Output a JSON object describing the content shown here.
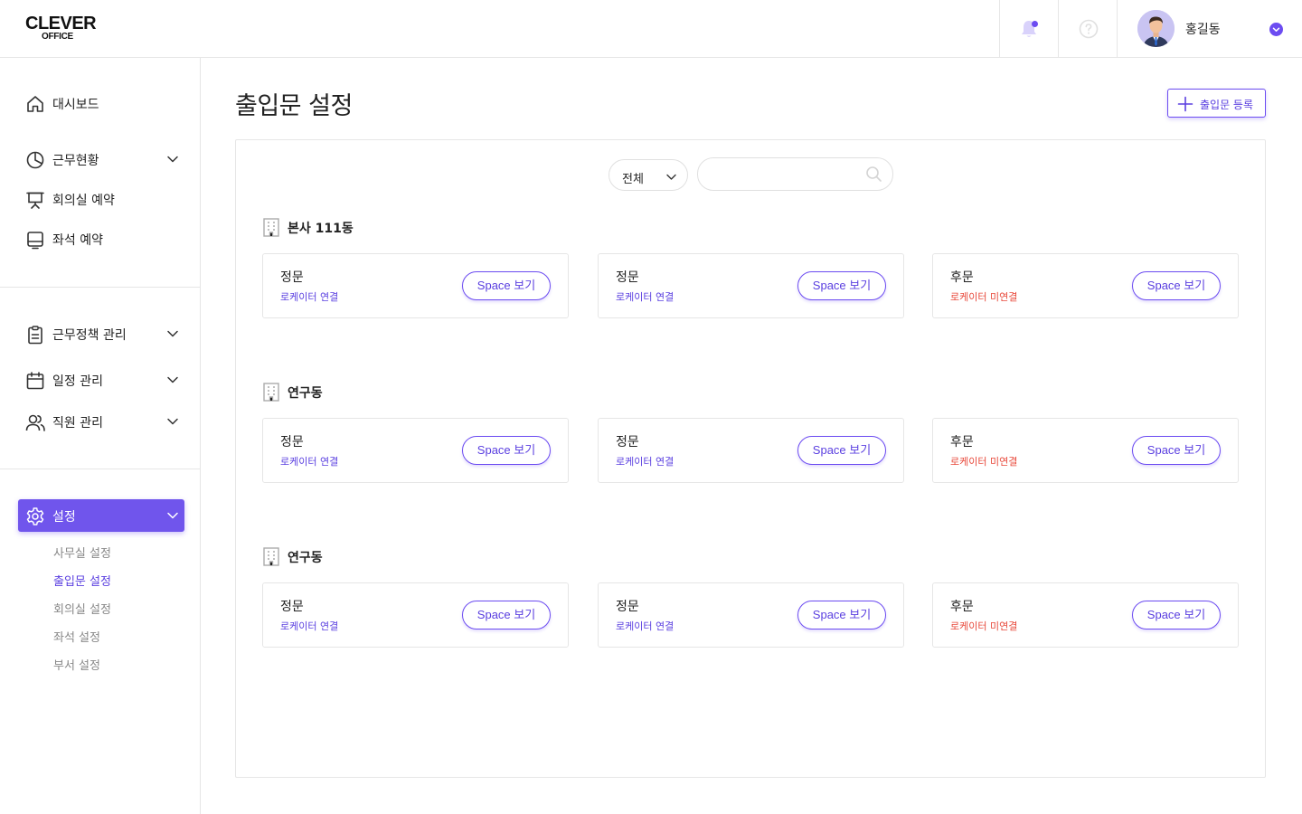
{
  "brand": {
    "line1": "CLEVER",
    "line2": "OFFICE"
  },
  "header": {
    "user_name": "홍길동"
  },
  "sidebar": {
    "items": [
      {
        "label": "대시보드"
      },
      {
        "label": "근무현황"
      },
      {
        "label": "회의실 예약"
      },
      {
        "label": "좌석 예약"
      },
      {
        "label": "근무정책 관리"
      },
      {
        "label": "일정 관리"
      },
      {
        "label": "직원 관리"
      },
      {
        "label": "설정"
      }
    ],
    "sub_items": [
      {
        "label": "사무실 설정"
      },
      {
        "label": "출입문 설정"
      },
      {
        "label": "회의실 설정"
      },
      {
        "label": "좌석 설정"
      },
      {
        "label": "부서 설정"
      }
    ]
  },
  "main": {
    "title": "출입문 설정",
    "add_button": "출입문 등록",
    "filter": {
      "selected": "전체"
    },
    "search": {
      "value": "",
      "placeholder": ""
    },
    "space_button_label": "Space 보기",
    "groups": [
      {
        "name": "본사 111동",
        "doors": [
          {
            "name": "정문",
            "status": "로케이터 연결",
            "connected": true
          },
          {
            "name": "정문",
            "status": "로케이터 연결",
            "connected": true
          },
          {
            "name": "후문",
            "status": "로케이터 미연결",
            "connected": false
          }
        ]
      },
      {
        "name": "연구동",
        "doors": [
          {
            "name": "정문",
            "status": "로케이터 연결",
            "connected": true
          },
          {
            "name": "정문",
            "status": "로케이터 연결",
            "connected": true
          },
          {
            "name": "후문",
            "status": "로케이터 미연결",
            "connected": false
          }
        ]
      },
      {
        "name": "연구동",
        "doors": [
          {
            "name": "정문",
            "status": "로케이터 연결",
            "connected": true
          },
          {
            "name": "정문",
            "status": "로케이터 연결",
            "connected": true
          },
          {
            "name": "후문",
            "status": "로케이터 미연결",
            "connected": false
          }
        ]
      }
    ]
  },
  "icons": {
    "bell": "bell-icon",
    "help": "help-icon",
    "dashboard": "home-icon",
    "attendance": "pie-chart-icon",
    "meeting": "presentation-icon",
    "seat": "monitor-icon",
    "policy": "clipboard-icon",
    "schedule": "calendar-icon",
    "staff": "users-icon",
    "settings": "gear-icon",
    "building": "building-icon",
    "search": "search-icon",
    "plus": "plus-icon",
    "chevron": "chevron-down-icon"
  },
  "colors": {
    "accent": "#6c4cf1",
    "accent_text": "#5a3fe0",
    "disconnected": "#e8493b"
  }
}
